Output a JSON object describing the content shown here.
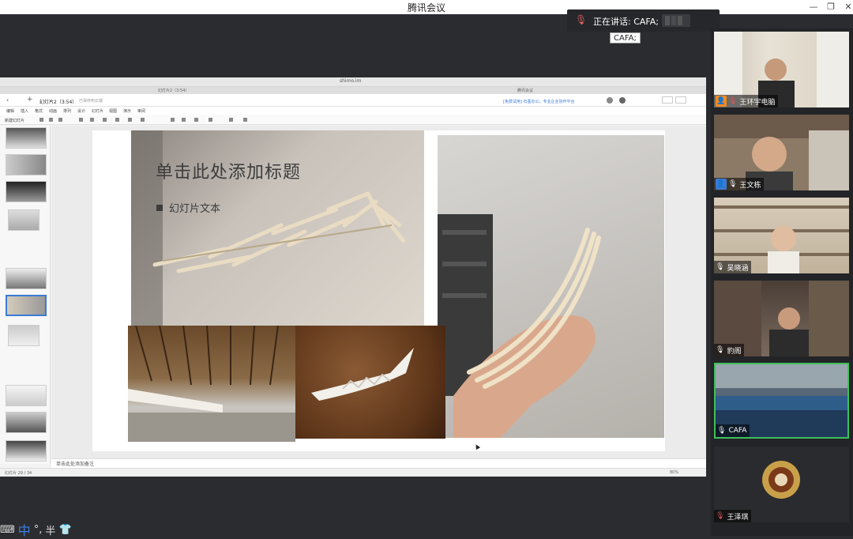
{
  "window": {
    "title": "腾讯会议"
  },
  "speaking": {
    "label": "正在讲话: CAFA;",
    "tooltip": "CAFA;"
  },
  "browser": {
    "url": "shimo.im",
    "tab_left": "幻灯片2（3:54）",
    "tab_right": "腾讯会议"
  },
  "app": {
    "doc_title": "幻灯片2（3:54）",
    "save_status": "已保存到云端",
    "promo": "[免费试用] 石墨办公，专业企业协作平台",
    "menu": [
      "编辑",
      "插入",
      "格式",
      "动画",
      "排列",
      "设计",
      "幻灯片",
      "视图",
      "演示",
      "审阅"
    ],
    "new_slide": "新建幻灯片"
  },
  "slide": {
    "title": "单击此处添加标题",
    "bullet": "幻灯片文本"
  },
  "notes": {
    "placeholder": "单击此处添加备注"
  },
  "status": {
    "slide_count": "幻灯片 29 / 34",
    "zoom": "80%"
  },
  "participants": [
    {
      "name": "王环宇电脑",
      "role": "host",
      "mic": "muted"
    },
    {
      "name": "王文栋",
      "role": "cohost",
      "mic": "on"
    },
    {
      "name": "吴晓涵",
      "role": "",
      "mic": "on"
    },
    {
      "name": "豹阁",
      "role": "",
      "mic": "on"
    },
    {
      "name": "CAFA",
      "role": "",
      "mic": "on",
      "active": true
    },
    {
      "name": "王泽琪",
      "role": "",
      "mic": "muted"
    }
  ],
  "ime": {
    "lang": "中",
    "punct": "°,",
    "width": "半"
  }
}
